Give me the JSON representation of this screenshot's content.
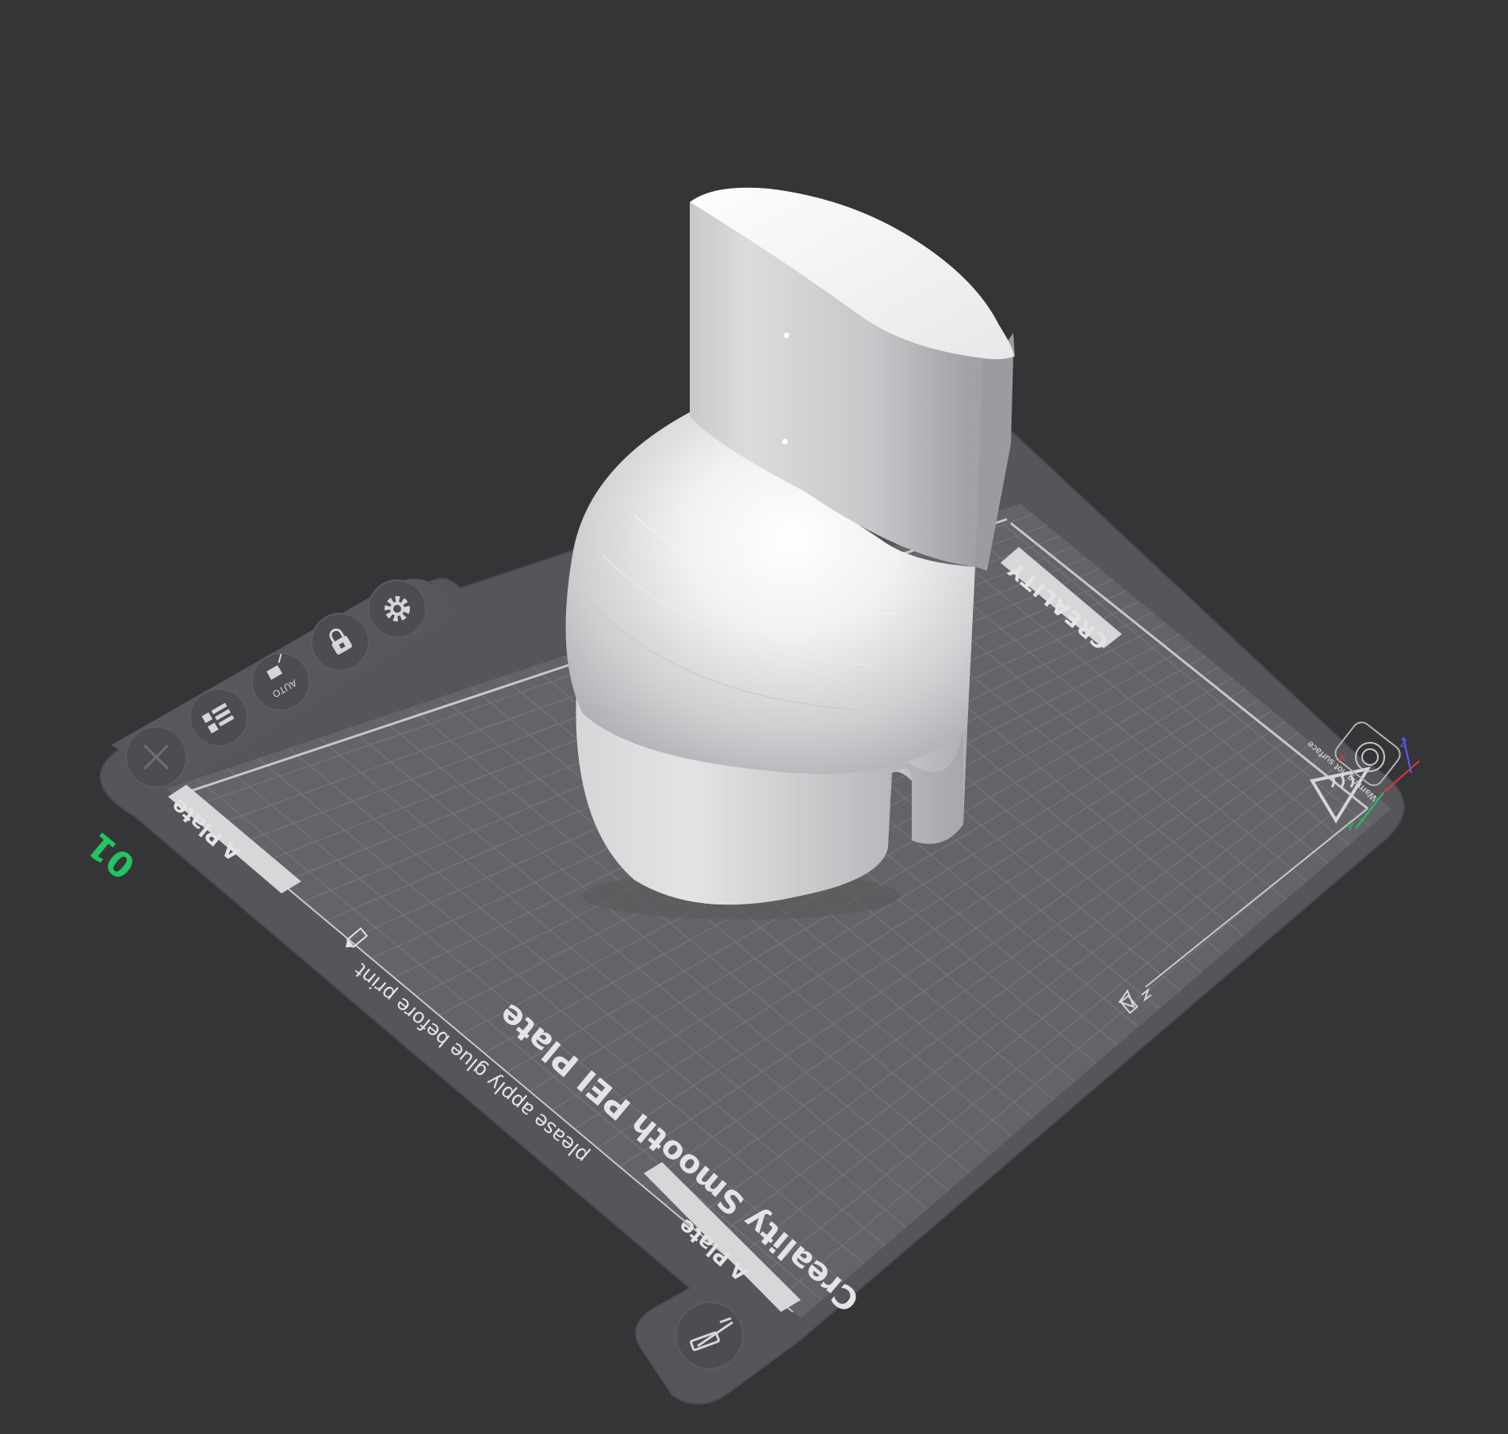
{
  "scene": {
    "background_color": "#353538",
    "plate_color": "#646468",
    "plate_border_color": "#56565a",
    "grid_color": "#75757a",
    "model_color": "#e6e6e8",
    "plate_number_color": "#22c55e"
  },
  "plate": {
    "number": "01",
    "brand": "CREALITY",
    "title": "Creality Smooth PEI Plate",
    "subtitle": "please apply glue before print",
    "side_label_a": "A Plate",
    "side_label_b": "A Plate",
    "warning_text": "Warning hot surface"
  },
  "toolbar": {
    "delete_icon": "close-icon",
    "arrange_icon": "arrange-icon",
    "auto_orient_label": "AUTO",
    "lock_icon": "lock-icon",
    "settings_icon": "gear-icon",
    "edit_icon": "pencil-icon"
  },
  "axes": {
    "x_label": "X",
    "y_label": "Y",
    "z_label": "Z",
    "x_color": "#e53935",
    "y_color": "#22c55e",
    "z_color": "#5b5bff"
  }
}
